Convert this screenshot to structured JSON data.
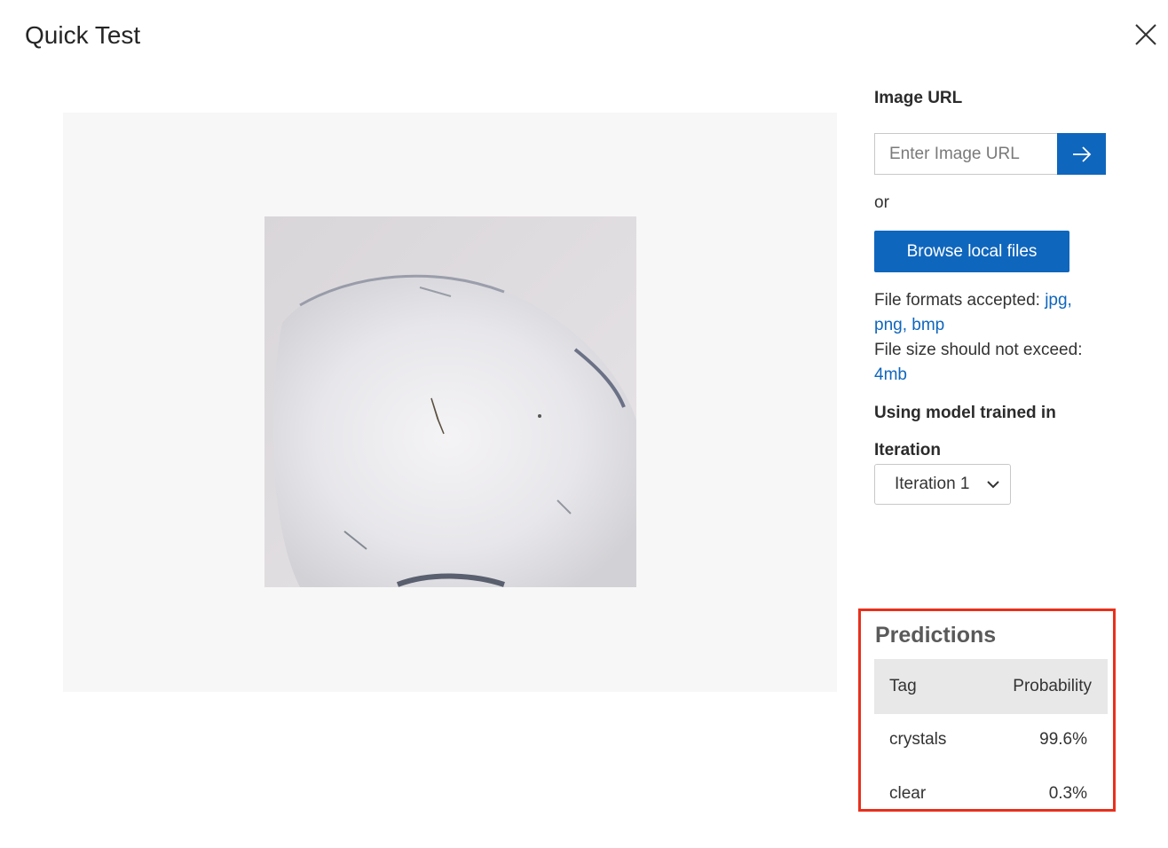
{
  "dialog": {
    "title": "Quick Test"
  },
  "image_url": {
    "label": "Image URL",
    "placeholder": "Enter Image URL"
  },
  "or_text": "or",
  "browse": {
    "label": "Browse local files"
  },
  "formats": {
    "accepted_label": "File formats accepted: ",
    "accepted_values": "jpg, png, bmp",
    "size_label": "File size should not exceed: ",
    "size_value": "4mb"
  },
  "model": {
    "label": "Using model trained in",
    "iteration_label": "Iteration",
    "iteration_selected": "Iteration 1"
  },
  "predictions": {
    "title": "Predictions",
    "columns": [
      "Tag",
      "Probability"
    ],
    "rows": [
      {
        "tag": "crystals",
        "probability": "99.6%"
      },
      {
        "tag": "clear",
        "probability": "0.3%"
      }
    ]
  },
  "colors": {
    "accent": "#0f66bd",
    "highlight_border": "#e8301c",
    "panel_bg": "#f7f7f7"
  },
  "icons": {
    "close": "close-icon",
    "submit": "arrow-right-icon",
    "dropdown": "chevron-down-icon"
  }
}
